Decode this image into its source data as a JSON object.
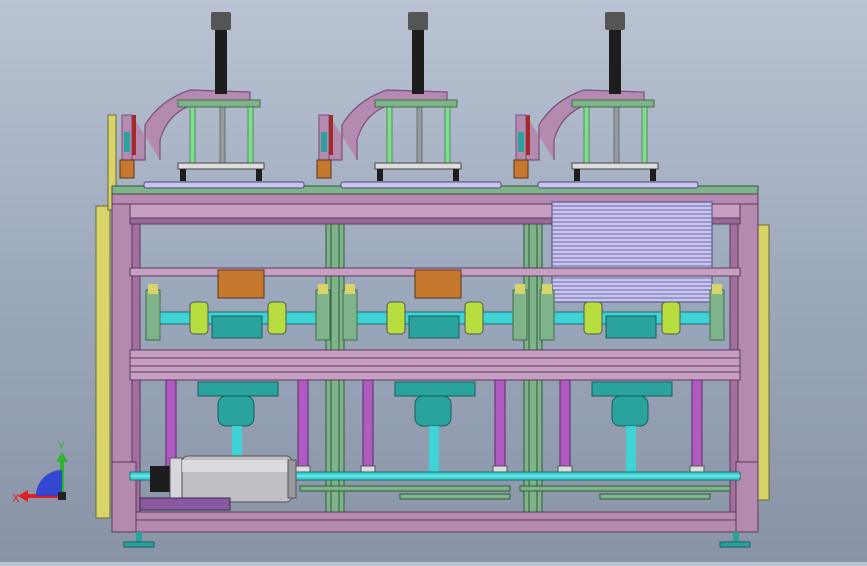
{
  "viewport": {
    "background": "#a3adbf",
    "colors": {
      "frame_purple": "#b58ab1",
      "frame_purple_dark": "#7b4f78",
      "rail_green": "#7fb38a",
      "rail_green_dark": "#3f6e4a",
      "cyan": "#3fd3d6",
      "teal": "#2aa39f",
      "yellow": "#d9d46a",
      "lavender": "#c8c4ec",
      "orange": "#c7782f",
      "black": "#1d1d1d",
      "olive": "#8f8d2c",
      "magenta": "#b15bc2",
      "motor_gray": "#bfbfc4"
    },
    "station_count": 3,
    "components": {
      "pneumatic_cylinder": "pneumatic-cylinder-icon",
      "clamp_arm": "clamp-arm-icon",
      "guide_rods": "guide-rod-icon",
      "roller_assembly": "roller-assembly-icon",
      "gear_motor": "gear-motor-icon",
      "drive_motor": "drive-motor-icon",
      "drive_shaft": "drive-shaft-icon",
      "plate_stack": "plate-stack-icon",
      "leveling_foot": "leveling-foot-icon"
    }
  },
  "triad": {
    "x_label": "X",
    "y_label": "Y",
    "x_color": "#e02020",
    "y_color": "#2fb62f",
    "z_color": "#2b3fd6"
  }
}
